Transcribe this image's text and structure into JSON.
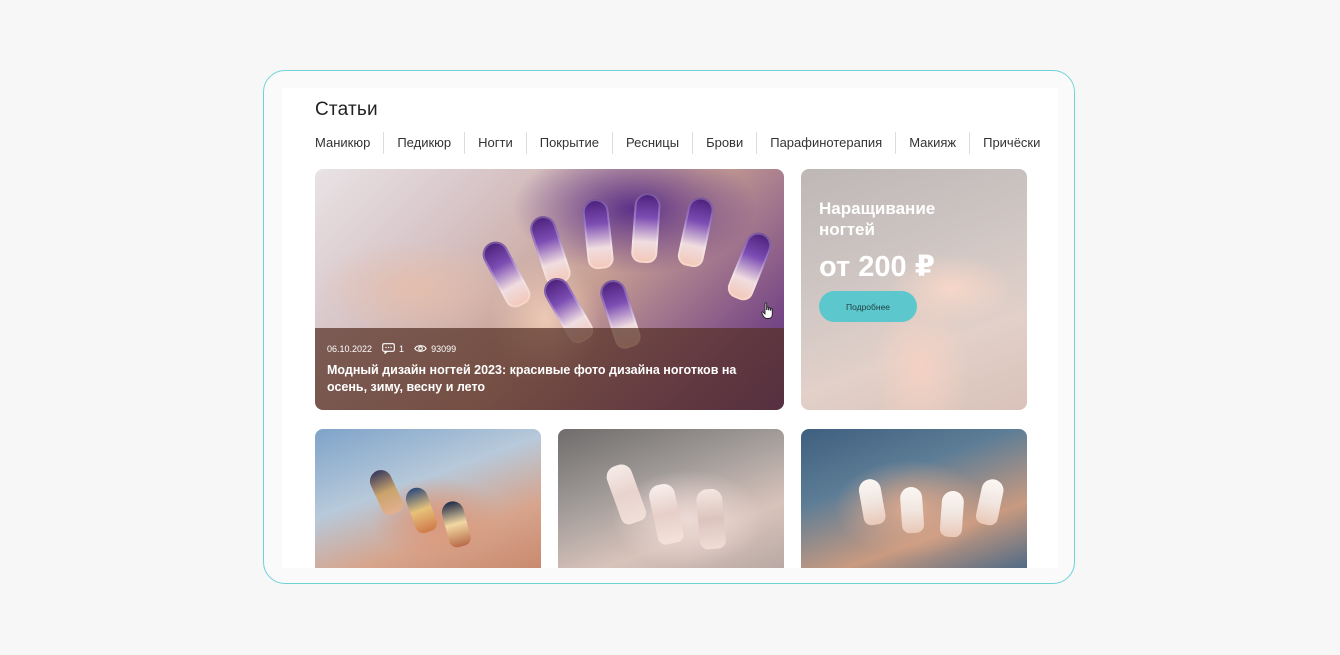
{
  "section_title": "Статьи",
  "tabs": [
    "Маникюр",
    "Педикюр",
    "Ногти",
    "Покрытие",
    "Ресницы",
    "Брови",
    "Парафинотерапия",
    "Макияж",
    "Причёски"
  ],
  "featured": {
    "date": "06.10.2022",
    "comments": "1",
    "views": "93099",
    "title": "Модный дизайн ногтей 2023: красивые фото дизайна ноготков на осень, зиму, весну и лето"
  },
  "promo": {
    "title": "Наращивание ногтей",
    "price": "от 200 ₽",
    "button": "Подробнее",
    "button_color": "#5cc8cd"
  },
  "colors": {
    "frame_border": "#6fd3d6",
    "background": "#f7f7f7"
  }
}
